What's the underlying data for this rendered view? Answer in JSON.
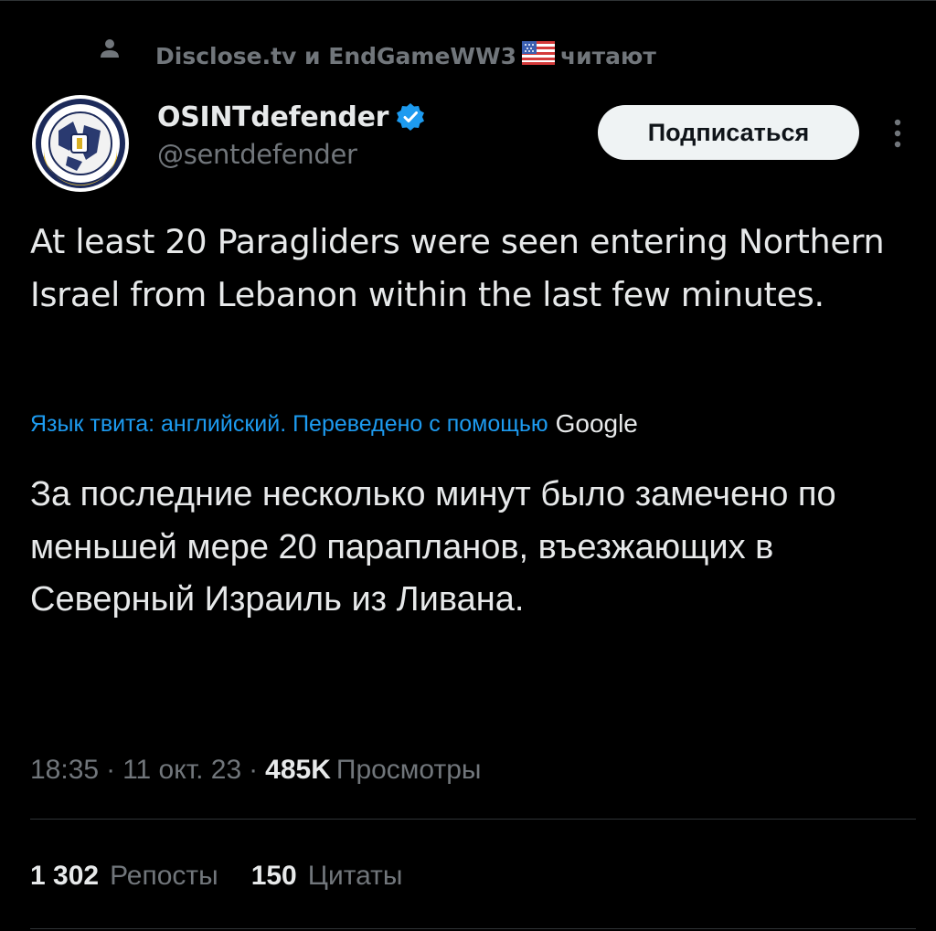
{
  "colors": {
    "background": "#000000",
    "text_primary": "#e7e9ea",
    "text_secondary": "#71767b",
    "link_blue": "#1d9bf0",
    "button_bg": "#eff3f4",
    "button_text": "#0f1419",
    "divider": "#2f3336"
  },
  "social_context": {
    "icon": "person-icon",
    "followers_text": "Disclose.tv и EndGameWW3",
    "flag_icon": "us-flag-icon",
    "suffix": "читают"
  },
  "author": {
    "avatar_icon": "osint-defender-avatar",
    "display_name": "OSINTdefender",
    "verified_icon": "verified-badge-icon",
    "handle": "@sentdefender"
  },
  "follow_button": {
    "label": "Подписаться"
  },
  "more_button": {
    "icon": "more-vertical-icon"
  },
  "tweet": {
    "text": "At least 20 Paragliders were seen entering Northern Israel from Lebanon within the last few minutes.",
    "translation_note": "Язык твита: английский. Переведено с помощью",
    "translation_provider": "Google",
    "translated_text": "За последние несколько минут было замечено по меньшей мере 20 парапланов, въезжающих в Северный Израиль из Ливана."
  },
  "meta": {
    "time": "18:35",
    "separator": "·",
    "date": "11 окт. 23",
    "views_count": "485K",
    "views_label": "Просмотры"
  },
  "stats": {
    "reposts_count": "1 302",
    "reposts_label": "Репосты",
    "quotes_count": "150",
    "quotes_label": "Цитаты"
  }
}
